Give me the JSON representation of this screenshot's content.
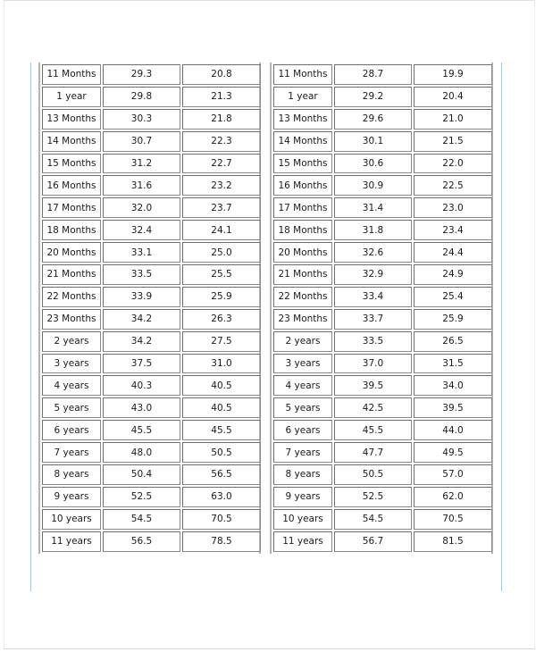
{
  "document": {
    "tables": [
      {
        "id": "left",
        "rows": [
          {
            "age": "11 Months",
            "value1": "29.3",
            "value2": "20.8"
          },
          {
            "age": "1 year",
            "value1": "29.8",
            "value2": "21.3"
          },
          {
            "age": "13 Months",
            "value1": "30.3",
            "value2": "21.8"
          },
          {
            "age": "14 Months",
            "value1": "30.7",
            "value2": "22.3"
          },
          {
            "age": "15 Months",
            "value1": "31.2",
            "value2": "22.7"
          },
          {
            "age": "16 Months",
            "value1": "31.6",
            "value2": "23.2"
          },
          {
            "age": "17 Months",
            "value1": "32.0",
            "value2": "23.7"
          },
          {
            "age": "18 Months",
            "value1": "32.4",
            "value2": "24.1"
          },
          {
            "age": "20 Months",
            "value1": "33.1",
            "value2": "25.0"
          },
          {
            "age": "21 Months",
            "value1": "33.5",
            "value2": "25.5"
          },
          {
            "age": "22 Months",
            "value1": "33.9",
            "value2": "25.9"
          },
          {
            "age": "23 Months",
            "value1": "34.2",
            "value2": "26.3"
          },
          {
            "age": "2 years",
            "value1": "34.2",
            "value2": "27.5"
          },
          {
            "age": "3 years",
            "value1": "37.5",
            "value2": "31.0"
          },
          {
            "age": "4 years",
            "value1": "40.3",
            "value2": "40.5"
          },
          {
            "age": "5 years",
            "value1": "43.0",
            "value2": "40.5"
          },
          {
            "age": "6 years",
            "value1": "45.5",
            "value2": "45.5"
          },
          {
            "age": "7 years",
            "value1": "48.0",
            "value2": "50.5"
          },
          {
            "age": "8 years",
            "value1": "50.4",
            "value2": "56.5"
          },
          {
            "age": "9 years",
            "value1": "52.5",
            "value2": "63.0"
          },
          {
            "age": "10 years",
            "value1": "54.5",
            "value2": "70.5"
          },
          {
            "age": "11 years",
            "value1": "56.5",
            "value2": "78.5"
          }
        ]
      },
      {
        "id": "right",
        "rows": [
          {
            "age": "11 Months",
            "value1": "28.7",
            "value2": "19.9"
          },
          {
            "age": "1 year",
            "value1": "29.2",
            "value2": "20.4"
          },
          {
            "age": "13 Months",
            "value1": "29.6",
            "value2": "21.0"
          },
          {
            "age": "14 Months",
            "value1": "30.1",
            "value2": "21.5"
          },
          {
            "age": "15 Months",
            "value1": "30.6",
            "value2": "22.0"
          },
          {
            "age": "16 Months",
            "value1": "30.9",
            "value2": "22.5"
          },
          {
            "age": "17 Months",
            "value1": "31.4",
            "value2": "23.0"
          },
          {
            "age": "18 Months",
            "value1": "31.8",
            "value2": "23.4"
          },
          {
            "age": "20 Months",
            "value1": "32.6",
            "value2": "24.4"
          },
          {
            "age": "21 Months",
            "value1": "32.9",
            "value2": "24.9"
          },
          {
            "age": "22 Months",
            "value1": "33.4",
            "value2": "25.4"
          },
          {
            "age": "23 Months",
            "value1": "33.7",
            "value2": "25.9"
          },
          {
            "age": "2 years",
            "value1": "33.5",
            "value2": "26.5"
          },
          {
            "age": "3 years",
            "value1": "37.0",
            "value2": "31.5"
          },
          {
            "age": "4 years",
            "value1": "39.5",
            "value2": "34.0"
          },
          {
            "age": "5 years",
            "value1": "42.5",
            "value2": "39.5"
          },
          {
            "age": "6 years",
            "value1": "45.5",
            "value2": "44.0"
          },
          {
            "age": "7 years",
            "value1": "47.7",
            "value2": "49.5"
          },
          {
            "age": "8 years",
            "value1": "50.5",
            "value2": "57.0"
          },
          {
            "age": "9 years",
            "value1": "52.5",
            "value2": "62.0"
          },
          {
            "age": "10 years",
            "value1": "54.5",
            "value2": "70.5"
          },
          {
            "age": "11 years",
            "value1": "56.7",
            "value2": "81.5"
          }
        ]
      }
    ]
  }
}
